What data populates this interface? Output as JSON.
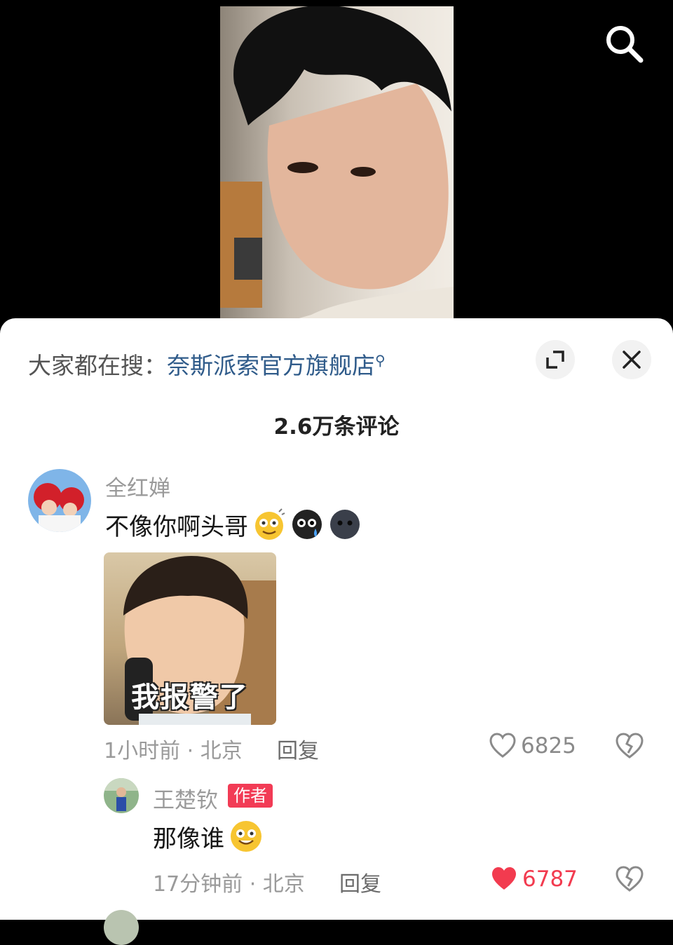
{
  "header": {
    "search_icon": "search-icon"
  },
  "sheet": {
    "suggest_prefix": "大家都在搜：",
    "suggest_term": "奈斯派索官方旗舰店",
    "expand_icon": "expand-icon",
    "close_icon": "close-icon",
    "comment_count": "2.6万条评论"
  },
  "comments": [
    {
      "username": "全红婵",
      "text": "不像你啊头哥",
      "emojis": [
        "wink-emoji",
        "tear-emoji",
        "dark-face-emoji"
      ],
      "meme_caption": "我报警了",
      "time_location": "1小时前 · 北京",
      "reply_label": "回复",
      "likes": "6825",
      "liked": false
    }
  ],
  "reply": {
    "username": "王楚钦",
    "badge": "作者",
    "text": "那像谁",
    "emoji": "grin-emoji",
    "time_location": "17分钟前 · 北京",
    "reply_label": "回复",
    "likes": "6787",
    "liked": true
  },
  "colors": {
    "link": "#2f5b8a",
    "like_active": "#f23b4f",
    "badge": "#f23b55"
  }
}
